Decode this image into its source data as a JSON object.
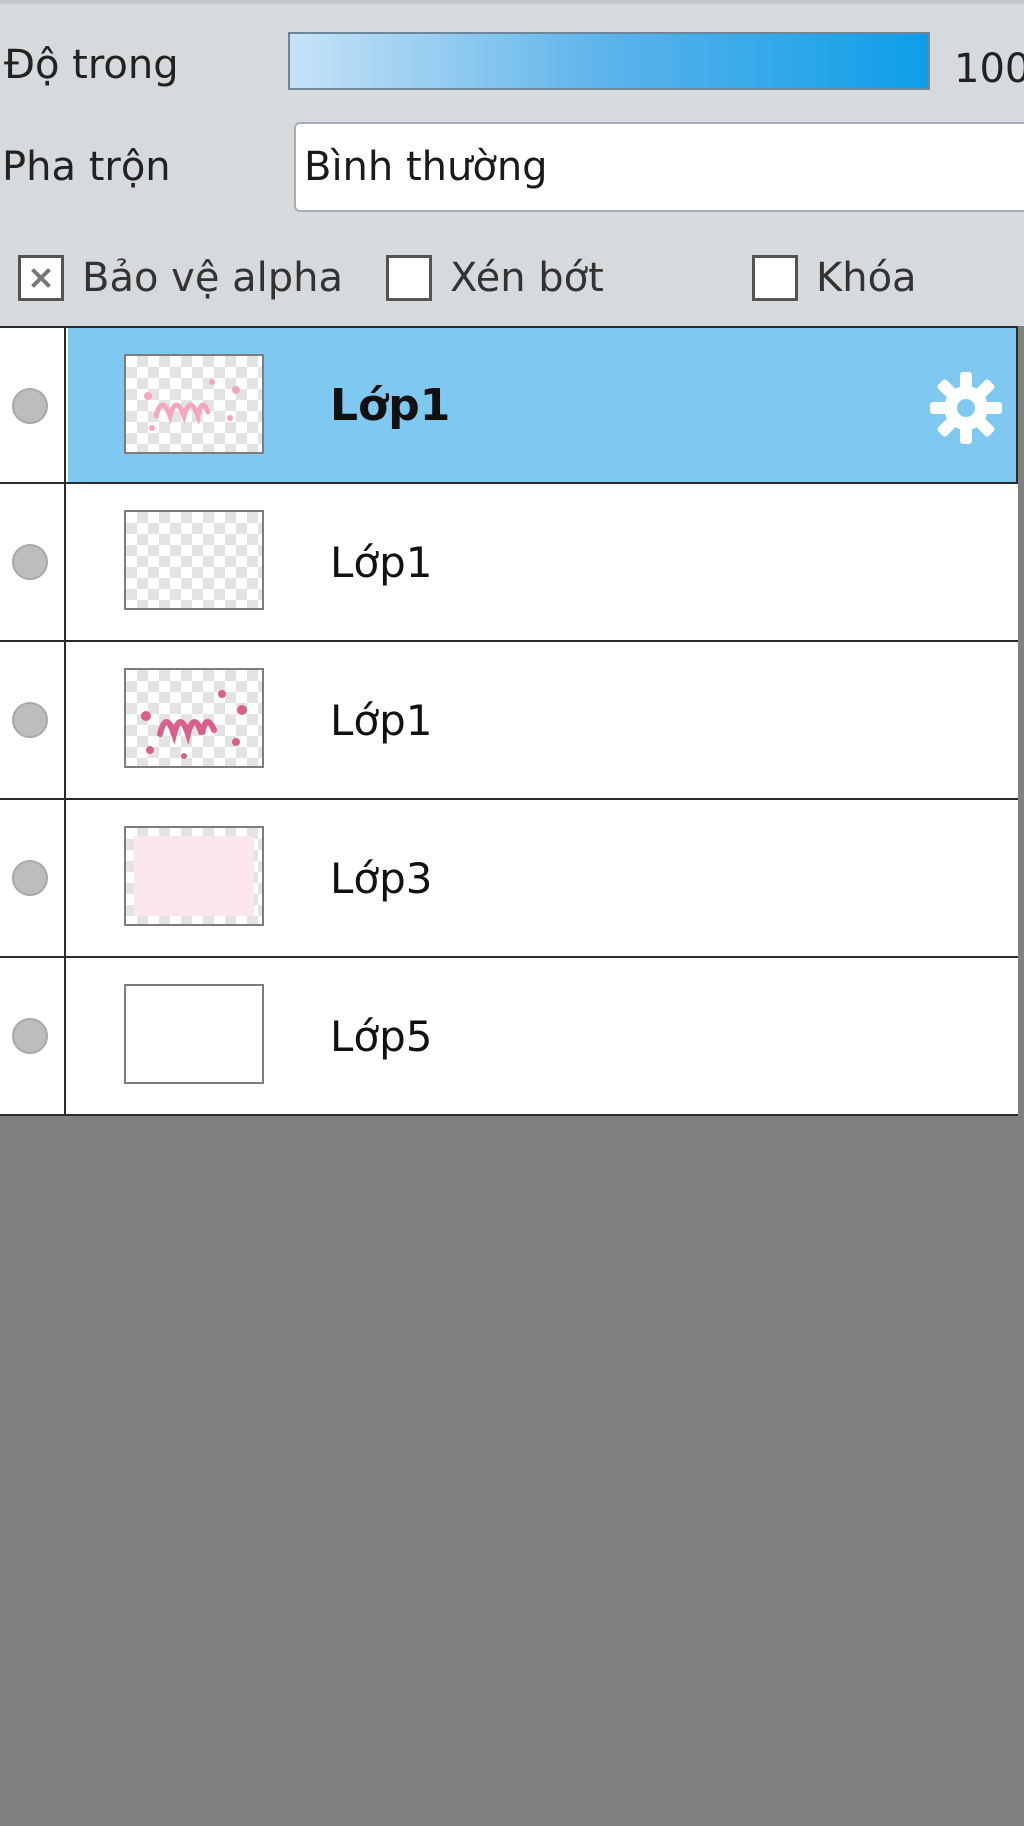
{
  "properties": {
    "opacity_label": "Độ trong",
    "opacity_value": "100",
    "opacity_level": 1.0,
    "blend_label": "Pha trộn",
    "blend_mode": "Bình thường",
    "options": [
      {
        "label": "Bảo vệ alpha",
        "checked": true
      },
      {
        "label": "Xén bớt",
        "checked": false
      },
      {
        "label": "Khóa",
        "checked": false
      }
    ]
  },
  "layers": [
    {
      "name": "Lớp1",
      "selected": true,
      "thumbnail": "light-pink-doodle",
      "settings_icon": "gear-icon"
    },
    {
      "name": "Lớp1",
      "selected": false,
      "thumbnail": "transparent"
    },
    {
      "name": "Lớp1",
      "selected": false,
      "thumbnail": "pink-doodle"
    },
    {
      "name": "Lớp3",
      "selected": false,
      "thumbnail": "pale-pink-fill"
    },
    {
      "name": "Lớp5",
      "selected": false,
      "thumbnail": "white"
    }
  ],
  "colors": {
    "panel_bg": "#d7dadd",
    "selected_row": "#7fc8f0",
    "slider_fill_end": "#0d9ee9",
    "empty_area": "#808080",
    "doodle_pink": "#d9608a"
  }
}
